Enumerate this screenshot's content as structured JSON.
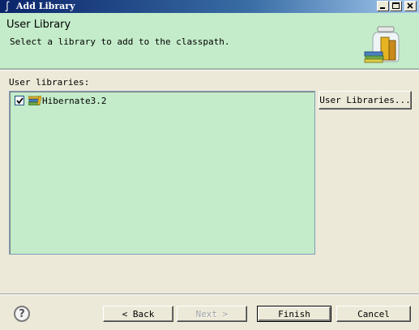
{
  "window": {
    "title": "Add Library",
    "controls": [
      "minimize",
      "maximize",
      "close"
    ]
  },
  "banner": {
    "title": "User Library",
    "description": "Select a library to add to the classpath.",
    "icon": "library-jar-icon"
  },
  "libraries": {
    "label": "User libraries:",
    "items": [
      {
        "name": "Hibernate3.2",
        "checked": true,
        "icon": "books-icon"
      }
    ],
    "manage_button": "User Libraries..."
  },
  "footer": {
    "help_icon": "help-icon",
    "back_label": "< Back",
    "next_label": "Next >",
    "next_enabled": false,
    "finish_label": "Finish",
    "cancel_label": "Cancel"
  },
  "colors": {
    "banner_bg": "#c4ecca",
    "list_bg": "#c4ecca",
    "dialog_bg": "#ece9d8",
    "titlebar_start": "#0a246a"
  }
}
